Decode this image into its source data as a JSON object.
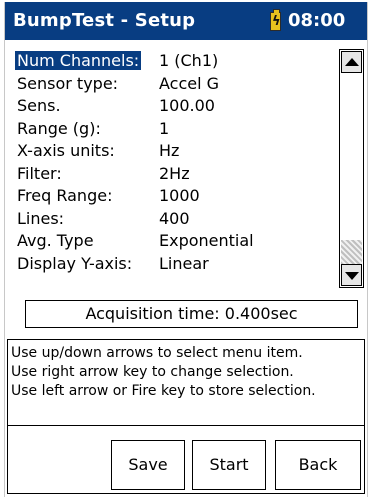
{
  "titlebar": {
    "title": "BumpTest - Setup",
    "time": "08:00",
    "battery_icon": "battery-charging-icon",
    "bolt": "ϟ"
  },
  "settings": [
    {
      "label": "Num Channels:",
      "value": "1 (Ch1)"
    },
    {
      "label": "Sensor type:",
      "value": "Accel G"
    },
    {
      "label": "Sens.",
      "value": "100.00"
    },
    {
      "label": "Range (g):",
      "value": "1"
    },
    {
      "label": "X-axis units:",
      "value": "Hz"
    },
    {
      "label": "Filter:",
      "value": "2Hz"
    },
    {
      "label": "Freq Range:",
      "value": "1000"
    },
    {
      "label": "Lines:",
      "value": "400"
    },
    {
      "label": "Avg. Type",
      "value": "Exponential"
    },
    {
      "label": "Display Y-axis:",
      "value": "Linear"
    }
  ],
  "selected_index": 0,
  "acquisition": "Acquisition time: 0.400sec",
  "help": [
    "Use up/down arrows to select menu item.",
    "Use right arrow key to change selection.",
    "Use left arrow or Fire key to store selection."
  ],
  "buttons": {
    "save": "Save",
    "start": "Start",
    "back": "Back"
  },
  "colors": {
    "titlebar": "#083d82",
    "selection": "#083d82",
    "battery": "#e6c11e"
  }
}
